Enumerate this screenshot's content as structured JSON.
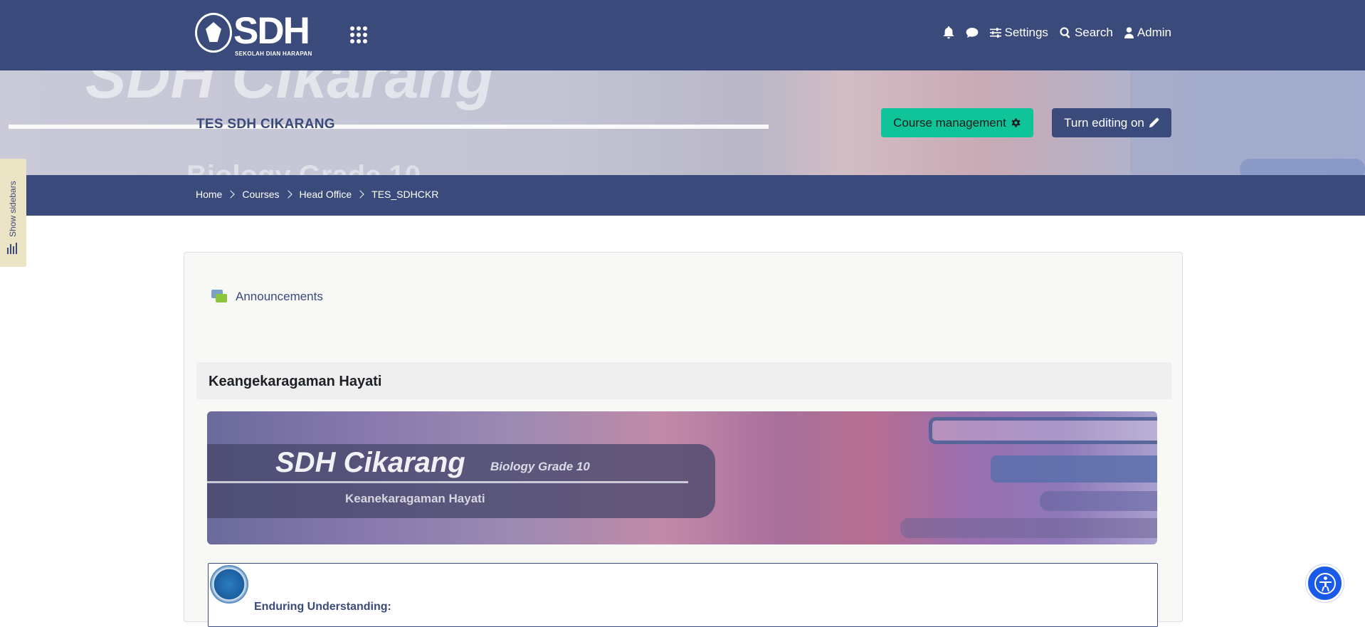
{
  "brand": {
    "logo_text": "SDH",
    "logo_subtext": "SEKOLAH DIAN HARAPAN"
  },
  "navbar": {
    "items": [
      {
        "label": "",
        "icon": "bell-icon"
      },
      {
        "label": "",
        "icon": "chat-icon"
      },
      {
        "label": "Settings",
        "icon": "sliders-icon"
      },
      {
        "label": "Search",
        "icon": "search-icon"
      },
      {
        "label": "Admin",
        "icon": "user-icon"
      }
    ]
  },
  "header": {
    "course_title": "TES SDH CIKARANG",
    "banner_ghost_title": "SDH Cikarang",
    "banner_ghost_subtitle": "Biology Grade 10",
    "course_management_label": "Course management",
    "turn_editing_label": "Turn editing on"
  },
  "breadcrumb": [
    "Home",
    "Courses",
    "Head Office",
    "TES_SDHCKR"
  ],
  "sidebar_toggle": {
    "label": "Show sidebars"
  },
  "main": {
    "announcements_label": "Announcements",
    "section_title": "Keangekaragaman Hayati",
    "section_banner": {
      "title": "SDH Cikarang",
      "grade": "Biology Grade 10",
      "subtitle": "Keanekaragaman Hayati"
    },
    "enduring_label": "Enduring Understanding:"
  },
  "colors": {
    "primary": "#3a4a7a",
    "accent_green": "#10c49a",
    "accessibility_blue": "#1a5ae8",
    "sidebar_toggle_bg": "#ece5c5"
  }
}
